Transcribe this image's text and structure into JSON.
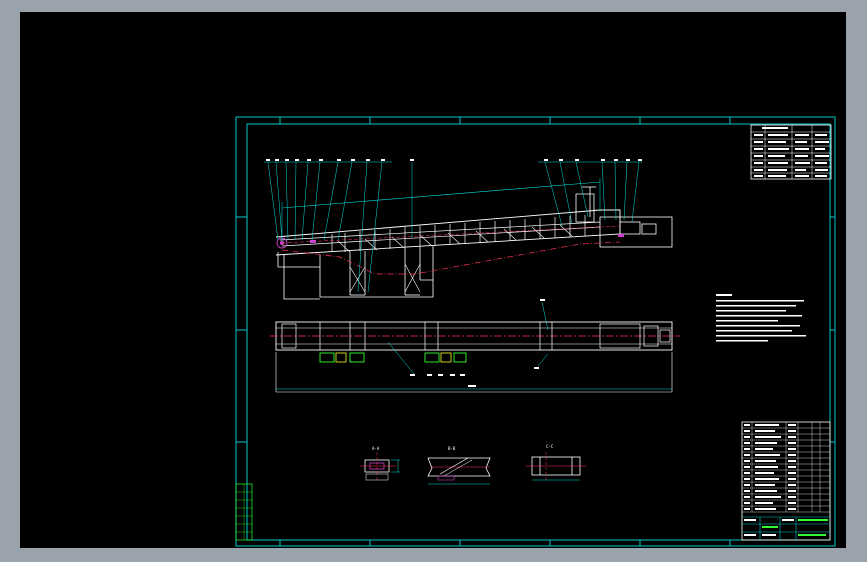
{
  "window": {
    "background": "#9aa3ab",
    "canvas_color": "#000000"
  },
  "colors": {
    "frame": "#00c8c8",
    "drawing": "#ffffff",
    "centerline": "#ff3355",
    "leader": "#00e0e0",
    "accent_magenta": "#d040d0",
    "accent_green": "#30ff30",
    "accent_yellow": "#e0e020"
  },
  "sections": {
    "a": "A-A",
    "b": "B-B",
    "c": "C-C"
  }
}
